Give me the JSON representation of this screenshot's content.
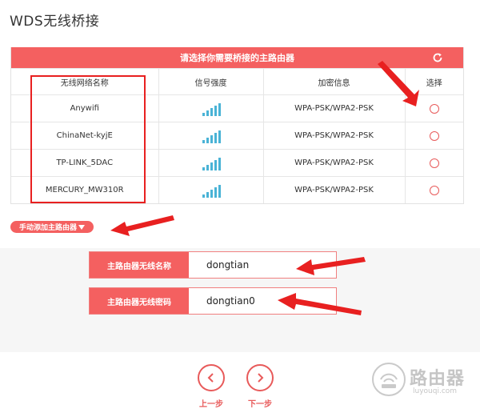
{
  "page": {
    "title": "WDS无线桥接"
  },
  "table": {
    "header_text": "请选择你需要桥接的主路由器",
    "columns": [
      "无线网络名称",
      "信号强度",
      "加密信息",
      "选择"
    ],
    "rows": [
      {
        "ssid": "Anywifi",
        "signal_bars": 5,
        "encryption": "WPA-PSK/WPA2-PSK"
      },
      {
        "ssid": "ChinaNet-kyjE",
        "signal_bars": 5,
        "encryption": "WPA-PSK/WPA2-PSK"
      },
      {
        "ssid": "TP-LINK_5DAC",
        "signal_bars": 5,
        "encryption": "WPA-PSK/WPA2-PSK"
      },
      {
        "ssid": "MERCURY_MW310R",
        "signal_bars": 5,
        "encryption": "WPA-PSK/WPA2-PSK"
      }
    ]
  },
  "manual": {
    "label": "手动添加主路由器"
  },
  "form": {
    "ssid_label": "主路由器无线名称",
    "ssid_value": "dongtian",
    "password_label": "主路由器无线密码",
    "password_value": "dongtian0"
  },
  "nav": {
    "prev_label": "上一步",
    "next_label": "下一步"
  },
  "watermark": {
    "text": "路由器",
    "sub": "luyouqi.com"
  },
  "icons": {
    "refresh": "refresh-icon",
    "signal": "wifi-signal-icon",
    "prev": "chevron-left-icon",
    "next": "chevron-right-icon"
  },
  "colors": {
    "accent": "#f46060",
    "signal": "#4ab3d6",
    "annotation": "#e82020"
  }
}
